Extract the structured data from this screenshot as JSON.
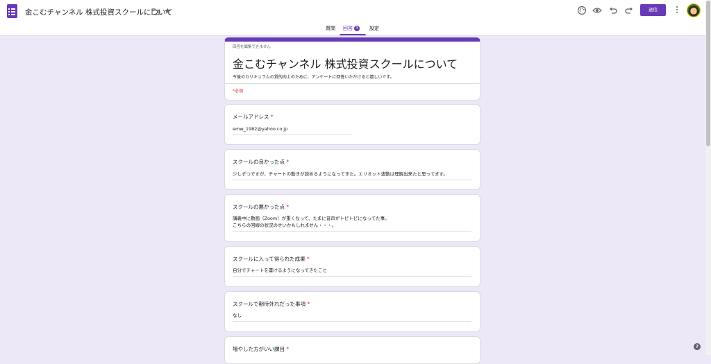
{
  "app": {
    "doc_title": "金こむチャンネル 株式投資スクールについて",
    "send_label": "送信"
  },
  "tabs": [
    {
      "label": "質問"
    },
    {
      "label": "回答",
      "badge": "3"
    },
    {
      "label": "設定"
    }
  ],
  "form": {
    "note": "回答を編集できません",
    "title": "金こむチャンネル 株式投資スクールについて",
    "description": "今後のカリキュラムの質的向上のために、アンケートに回答いただけると嬉しいです。",
    "required_note": "*必須",
    "questions": [
      {
        "label": "メールアドレス",
        "required": "*",
        "answer": "emw_1982@yahoo.co.jp"
      },
      {
        "label": "スクールの良かった点",
        "required": "*",
        "answer": "少しずつですが、チャートの動きが読めるようになってきた。エリオット波動は理解出来たと思ってます。"
      },
      {
        "label": "スクールの悪かった点",
        "required": "*",
        "answer_line1": "講義中に動画（Zoom）が重くなって、たまに音声がトビトビになってた事。",
        "answer_line2": "こちらの回線の状況のせいかもしれません・・・。"
      },
      {
        "label": "スクールに入って得られた成果",
        "required": "*",
        "answer": "自分でチャートを書けるようになってきたこと"
      },
      {
        "label": "スクールで期待外れだった事項",
        "required": "*",
        "answer": "なし"
      },
      {
        "label": "増やした方がいい課目",
        "required": "*"
      }
    ]
  },
  "colors": {
    "accent": "#673ab7",
    "background": "#ece8f7",
    "required": "#d93025"
  },
  "icons": [
    "forms-logo-icon",
    "folder-icon",
    "star-icon",
    "palette-icon",
    "preview-eye-icon",
    "undo-icon",
    "redo-icon",
    "more-vert-icon",
    "help-icon"
  ]
}
